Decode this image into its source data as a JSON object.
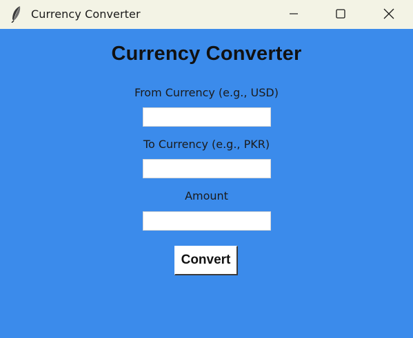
{
  "window": {
    "title": "Currency Converter",
    "icon": "feather-icon",
    "controls": [
      "minimize-icon",
      "maximize-icon",
      "close-icon"
    ]
  },
  "main": {
    "heading": "Currency Converter",
    "from_label": "From Currency (e.g., USD)",
    "from_value": "",
    "to_label": "To Currency (e.g., PKR)",
    "to_value": "",
    "amount_label": "Amount",
    "amount_value": "",
    "convert_label": "Convert"
  },
  "colors": {
    "background": "#3b8beb",
    "titlebar": "#f3f3e5"
  }
}
